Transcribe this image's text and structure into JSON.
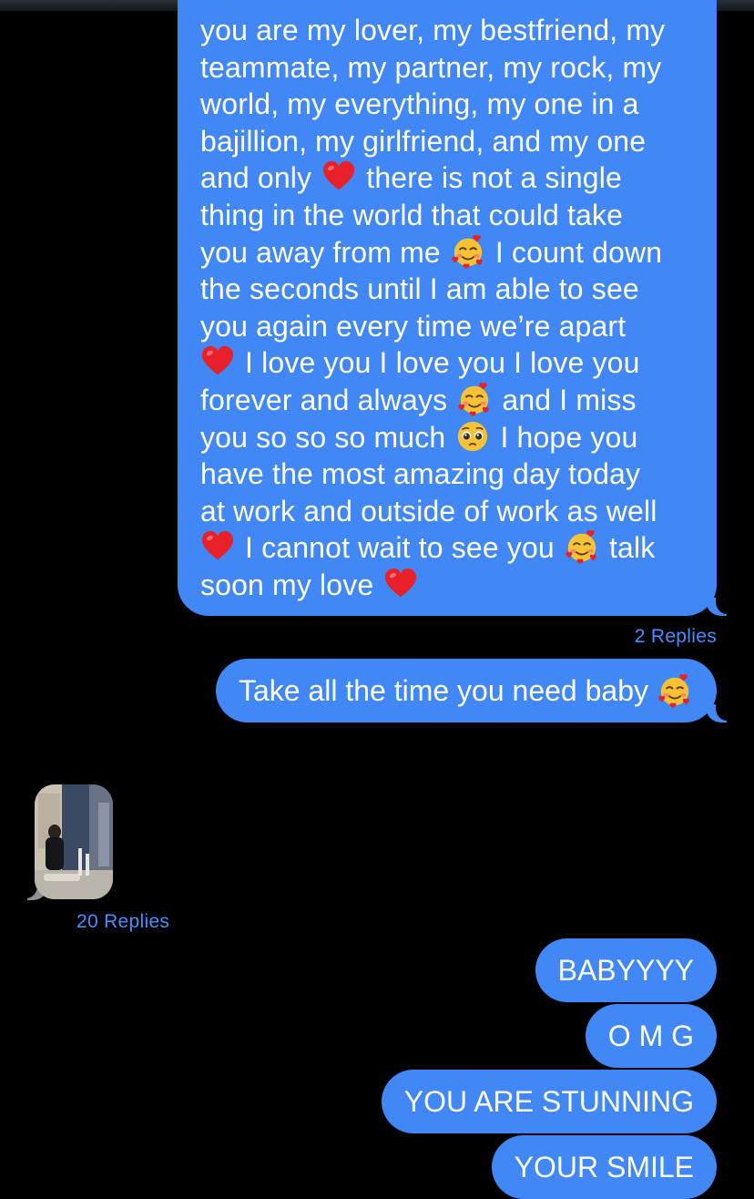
{
  "messages": {
    "long_message": {
      "line1": "you are my lover, my bestfriend, my",
      "line2": "teammate, my partner, my rock, my",
      "line3": "world, my everything, my one in a",
      "line4": "bajillion, my girlfriend, and my one",
      "line5a": "and only",
      "line5b": "there is not a single",
      "line6": "thing in the world that could take",
      "line7a": "you away from me",
      "line7b": "I count down",
      "line8": "the seconds until I am able to see",
      "line9": "you again every time we’re apart",
      "line10": "I love you I love you I love you",
      "line11a": "forever and always",
      "line11b": "and I miss",
      "line12a": "you so so so much",
      "line12b": "I hope you",
      "line13": "have the most amazing day today",
      "line14": "at work and outside of work as well",
      "line15a": "I cannot wait to see you",
      "line15b": "talk",
      "line16": "soon my love",
      "replies": "2 Replies"
    },
    "take_time": "Take all the time you need baby",
    "photo_replies": "20 Replies",
    "babyyyy": "BABYYYY",
    "omg": "O M G",
    "stunning": "YOU ARE STUNNING",
    "smile": "YOUR SMILE"
  },
  "colors": {
    "bubble_blue": "#4187f5",
    "replies_blue": "#4a8fff",
    "background": "#000000"
  }
}
